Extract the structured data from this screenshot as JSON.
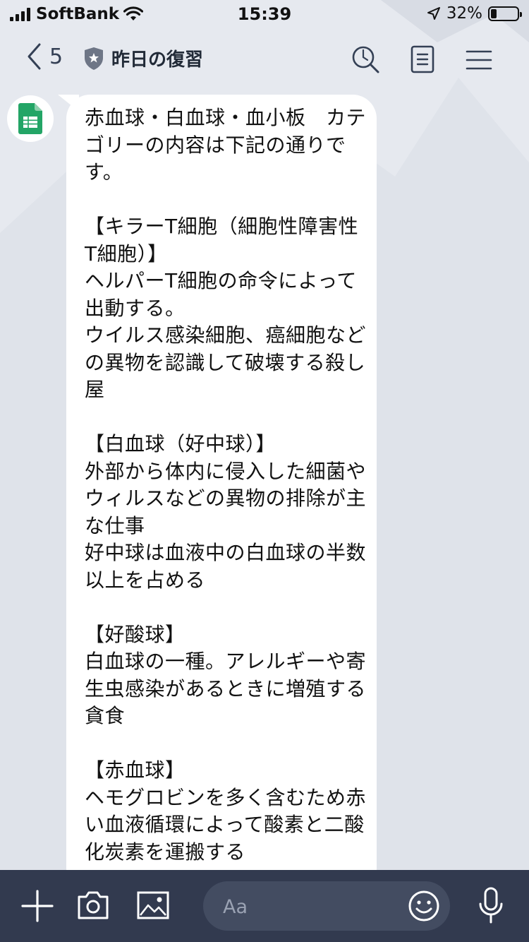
{
  "status_bar": {
    "carrier": "SoftBank",
    "time": "15:39",
    "battery_percent": "32%",
    "battery_level": 0.32,
    "icons": [
      "signal-icon",
      "wifi-icon",
      "location-icon",
      "battery-icon"
    ]
  },
  "header": {
    "back_count": "5",
    "title": "昨日の復習",
    "icons": [
      "back-chevron-icon",
      "shield-star-icon",
      "search-icon",
      "notes-icon",
      "menu-icon"
    ]
  },
  "chat": {
    "avatar_icon": "spreadsheet-icon",
    "message": "赤血球・白血球・血小板　カテゴリーの内容は下記の通りです。\n\n【キラーT細胞（細胞性障害性T細胞）】\nヘルパーT細胞の命令によって出動する。\nウイルス感染細胞、癌細胞などの異物を認識して破壊する殺し屋\n\n【白血球（好中球）】\n外部から体内に侵入した細菌やウィルスなどの異物の排除が主な仕事\n好中球は血液中の白血球の半数以上を占める\n\n【好酸球】\n白血球の一種。アレルギーや寄生虫感染があるときに増殖する貪食\n\n【赤血球】\nヘモグロビンを多く含むため赤い血液循環によって酸素と二酸化炭素を運搬する"
  },
  "toolbar": {
    "input_placeholder": "Aa",
    "icons": [
      "plus-icon",
      "camera-icon",
      "image-icon",
      "emoji-icon",
      "microphone-icon"
    ]
  },
  "colors": {
    "background": "#dfe3ea",
    "toolbar": "#323a4f",
    "input": "#434c61",
    "bubble": "#ffffff",
    "header_icons": "#344055",
    "sheets_green": "#23a566"
  }
}
